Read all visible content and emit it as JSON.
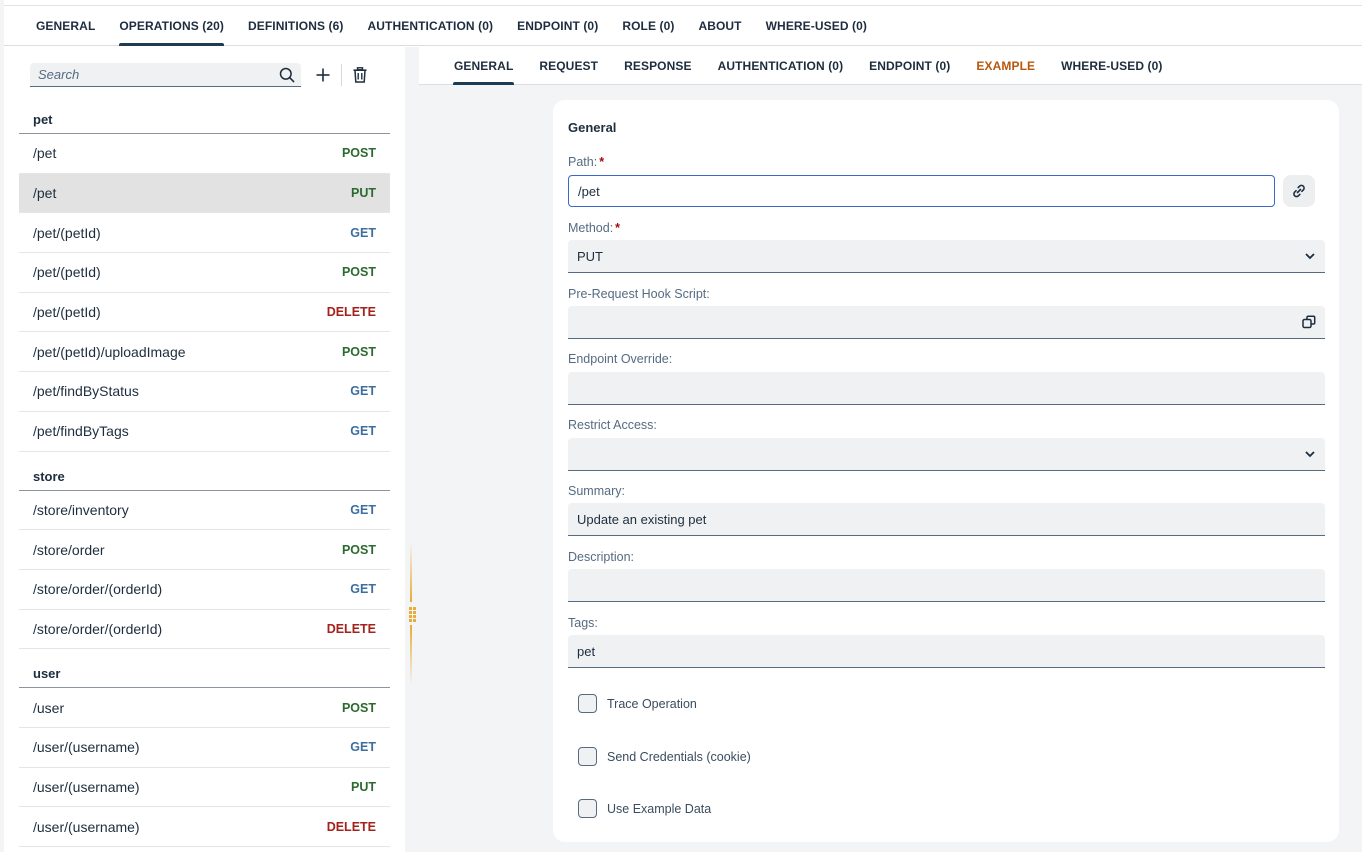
{
  "top_tabs": [
    {
      "label": "GENERAL",
      "active": false
    },
    {
      "label": "OPERATIONS (20)",
      "active": true
    },
    {
      "label": "DEFINITIONS (6)",
      "active": false
    },
    {
      "label": "AUTHENTICATION (0)",
      "active": false
    },
    {
      "label": "ENDPOINT (0)",
      "active": false
    },
    {
      "label": "ROLE (0)",
      "active": false
    },
    {
      "label": "ABOUT",
      "active": false
    },
    {
      "label": "WHERE-USED (0)",
      "active": false
    }
  ],
  "left_panel": {
    "search": {
      "placeholder": "Search",
      "value": ""
    },
    "icons": {
      "search": "search-icon",
      "add": "plus-icon",
      "delete": "trash-icon"
    },
    "groups": [
      {
        "name": "pet",
        "operations": [
          {
            "path": "/pet",
            "method": "POST",
            "selected": false
          },
          {
            "path": "/pet",
            "method": "PUT",
            "selected": true
          },
          {
            "path": "/pet/(petId)",
            "method": "GET",
            "selected": false
          },
          {
            "path": "/pet/(petId)",
            "method": "POST",
            "selected": false
          },
          {
            "path": "/pet/(petId)",
            "method": "DELETE",
            "selected": false
          },
          {
            "path": "/pet/(petId)/uploadImage",
            "method": "POST",
            "selected": false
          },
          {
            "path": "/pet/findByStatus",
            "method": "GET",
            "selected": false
          },
          {
            "path": "/pet/findByTags",
            "method": "GET",
            "selected": false
          }
        ]
      },
      {
        "name": "store",
        "operations": [
          {
            "path": "/store/inventory",
            "method": "GET",
            "selected": false
          },
          {
            "path": "/store/order",
            "method": "POST",
            "selected": false
          },
          {
            "path": "/store/order/(orderId)",
            "method": "GET",
            "selected": false
          },
          {
            "path": "/store/order/(orderId)",
            "method": "DELETE",
            "selected": false
          }
        ]
      },
      {
        "name": "user",
        "operations": [
          {
            "path": "/user",
            "method": "POST",
            "selected": false
          },
          {
            "path": "/user/(username)",
            "method": "GET",
            "selected": false
          },
          {
            "path": "/user/(username)",
            "method": "PUT",
            "selected": false
          },
          {
            "path": "/user/(username)",
            "method": "DELETE",
            "selected": false
          }
        ]
      }
    ]
  },
  "method_colors": {
    "POST": "#2b6a2f",
    "PUT": "#2b6a2f",
    "GET": "#3d6ea0",
    "DELETE": "#a4221c"
  },
  "sub_tabs": [
    {
      "label": "GENERAL",
      "active": true,
      "highlight": false
    },
    {
      "label": "REQUEST",
      "active": false,
      "highlight": false
    },
    {
      "label": "RESPONSE",
      "active": false,
      "highlight": false
    },
    {
      "label": "AUTHENTICATION (0)",
      "active": false,
      "highlight": false
    },
    {
      "label": "ENDPOINT (0)",
      "active": false,
      "highlight": false
    },
    {
      "label": "EXAMPLE",
      "active": false,
      "highlight": true
    },
    {
      "label": "WHERE-USED (0)",
      "active": false,
      "highlight": false
    }
  ],
  "form": {
    "title": "General",
    "path": {
      "label": "Path:",
      "required_mark": "*",
      "value": "/pet"
    },
    "method": {
      "label": "Method:",
      "required_mark": "*",
      "value": "PUT"
    },
    "pre_request_hook": {
      "label": "Pre-Request Hook Script:",
      "value": ""
    },
    "endpoint_override": {
      "label": "Endpoint Override:",
      "value": ""
    },
    "restrict_access": {
      "label": "Restrict Access:",
      "value": ""
    },
    "summary": {
      "label": "Summary:",
      "value": "Update an existing pet"
    },
    "description": {
      "label": "Description:",
      "value": ""
    },
    "tags": {
      "label": "Tags:",
      "value": "pet"
    },
    "checkboxes": [
      {
        "label": "Trace Operation",
        "checked": false
      },
      {
        "label": "Send Credentials (cookie)",
        "checked": false
      },
      {
        "label": "Use Example Data",
        "checked": false
      }
    ]
  }
}
